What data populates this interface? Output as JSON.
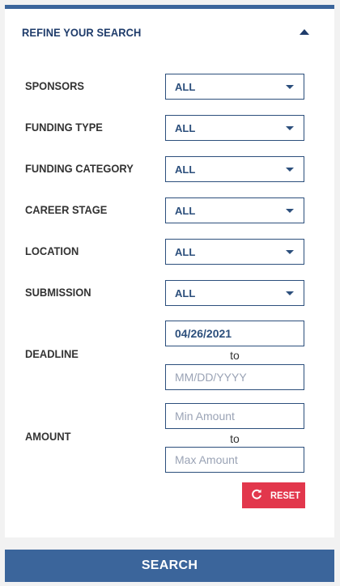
{
  "panel": {
    "title": "REFINE YOUR SEARCH"
  },
  "filters": {
    "sponsors": {
      "label": "SPONSORS",
      "value": "ALL"
    },
    "funding_type": {
      "label": "FUNDING TYPE",
      "value": "ALL"
    },
    "funding_category": {
      "label": "FUNDING CATEGORY",
      "value": "ALL"
    },
    "career_stage": {
      "label": "CAREER STAGE",
      "value": "ALL"
    },
    "location": {
      "label": "LOCATION",
      "value": "ALL"
    },
    "submission": {
      "label": "SUBMISSION",
      "value": "ALL"
    }
  },
  "deadline": {
    "label": "DEADLINE",
    "start_value": "04/26/2021",
    "end_placeholder": "MM/DD/YYYY",
    "to_text": "to"
  },
  "amount": {
    "label": "AMOUNT",
    "min_placeholder": "Min Amount",
    "max_placeholder": "Max Amount",
    "to_text": "to"
  },
  "buttons": {
    "reset_label": "RESET",
    "search_label": "SEARCH"
  },
  "colors": {
    "primary": "#3b659b",
    "accent_text": "#2c4f7c",
    "reset": "#e2374c"
  }
}
